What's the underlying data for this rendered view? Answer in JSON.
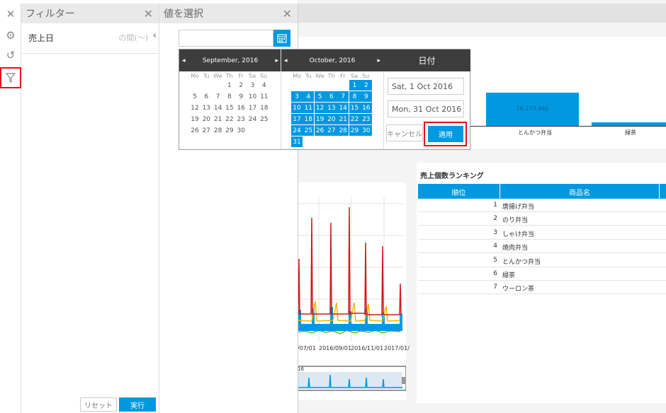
{
  "filter_panel": {
    "title": "フィルター",
    "item_label": "売上日",
    "item_value": "の間(〜)",
    "reset_label": "リセット",
    "run_label": "実行"
  },
  "value_panel": {
    "title": "値を選択",
    "search_value": ""
  },
  "calendar_left": {
    "month": "September, 2016",
    "dow": [
      "Mo",
      "Tu",
      "We",
      "Th",
      "Fr",
      "Sa",
      "Su"
    ]
  },
  "calendar_right": {
    "month": "October, 2016",
    "dow": [
      "Mo",
      "Tu",
      "We",
      "Th",
      "Fr",
      "Sa",
      "Su"
    ]
  },
  "date_pane": {
    "title": "日付",
    "start": "Sat, 1 Oct 2016",
    "end": "Mon, 31 Oct 2016",
    "cancel_label": "キャンセル",
    "apply_label": "適用"
  },
  "bar_chart": {
    "value_label": "16,273,460",
    "cat1": "とんかつ弁当",
    "cat2": "緑茶"
  },
  "line_chart": {
    "ticks": [
      "/07/01",
      "2016/09/01",
      "2016/11/01",
      "2017/01/"
    ],
    "nav_label": "16"
  },
  "ranking": {
    "title": "売上個数ランキング",
    "col_rank": "順位",
    "col_product": "商品名",
    "rows": [
      {
        "rank": "1",
        "name": "唐揚げ弁当"
      },
      {
        "rank": "2",
        "name": "のり弁当"
      },
      {
        "rank": "3",
        "name": "しゃけ弁当"
      },
      {
        "rank": "4",
        "name": "焼肉弁当"
      },
      {
        "rank": "5",
        "name": "とんかつ弁当"
      },
      {
        "rank": "6",
        "name": "緑茶"
      },
      {
        "rank": "7",
        "name": "ウーロン茶"
      }
    ]
  },
  "colors": {
    "accent": "#0099e0",
    "highlight": "#e0121c",
    "dark": "#3d3d3d"
  }
}
